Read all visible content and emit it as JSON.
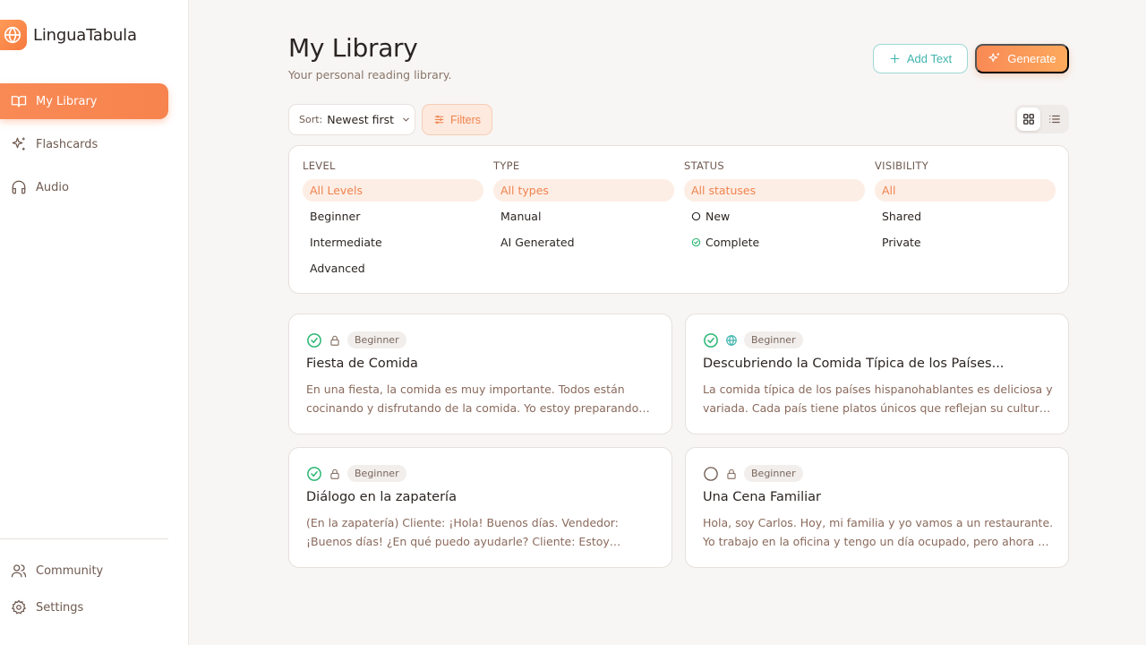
{
  "app": {
    "name": "LinguaTabula"
  },
  "sidebar": {
    "items": [
      {
        "label": "My Library",
        "icon": "book-icon",
        "active": true
      },
      {
        "label": "Flashcards",
        "icon": "sparkles-icon"
      },
      {
        "label": "Audio",
        "icon": "headphones-icon"
      }
    ],
    "bottom_items": [
      {
        "label": "Community",
        "icon": "users-icon"
      },
      {
        "label": "Settings",
        "icon": "gear-icon"
      }
    ]
  },
  "header": {
    "title": "My Library",
    "subtitle": "Your personal reading library.",
    "add_text_label": "Add Text",
    "generate_label": "Generate"
  },
  "toolbar": {
    "sort_label": "Sort:",
    "sort_value": "Newest first",
    "filters_label": "Filters",
    "view_mode": "grid"
  },
  "filters": {
    "level": {
      "heading": "LEVEL",
      "options": [
        "All Levels",
        "Beginner",
        "Intermediate",
        "Advanced"
      ],
      "selected": "All Levels"
    },
    "type": {
      "heading": "TYPE",
      "options": [
        "All types",
        "Manual",
        "AI Generated"
      ],
      "selected": "All types"
    },
    "status": {
      "heading": "STATUS",
      "options": [
        "All statuses",
        "New",
        "Complete"
      ],
      "selected": "All statuses"
    },
    "visibility": {
      "heading": "VISIBILITY",
      "options": [
        "All",
        "Shared",
        "Private"
      ],
      "selected": "All"
    }
  },
  "texts": [
    {
      "status": "complete",
      "visibility": "private",
      "level": "Beginner",
      "title": "Fiesta de Comida",
      "excerpt": "En una fiesta, la comida es muy importante. Todos están cocinando y disfrutando de la comida. Yo estoy preparando una paella. La..."
    },
    {
      "status": "complete",
      "visibility": "shared",
      "level": "Beginner",
      "title": "Descubriendo la Comida Típica de los Países...",
      "excerpt": "La comida típica de los países hispanohablantes es deliciosa y variada. Cada país tiene platos únicos que reflejan su cultura y..."
    },
    {
      "status": "complete",
      "visibility": "private",
      "level": "Beginner",
      "title": "Diálogo en la zapatería",
      "excerpt": "(En la zapatería) Cliente: ¡Hola! Buenos días. Vendedor: ¡Buenos días! ¿En qué puedo ayudarle? Cliente: Estoy buscando unos..."
    },
    {
      "status": "new",
      "visibility": "private",
      "level": "Beginner",
      "title": "Una Cena Familiar",
      "excerpt": "Hola, soy Carlos. Hoy, mi familia y yo vamos a un restaurante. Yo trabajo en la oficina y tengo un día ocupado, pero ahora es tiempo..."
    }
  ],
  "colors": {
    "accent": "#f7834e",
    "teal": "#3fb4ad",
    "success": "#2bb673",
    "text_muted": "#8a7568"
  }
}
